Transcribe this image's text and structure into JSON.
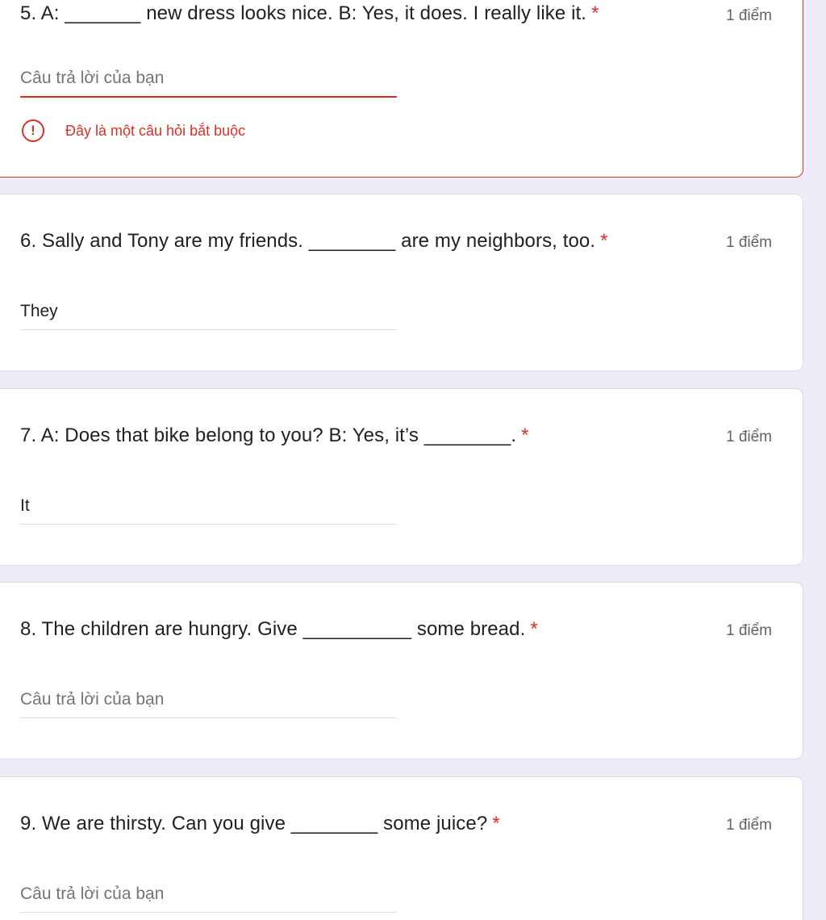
{
  "questions": [
    {
      "text": "5. A: _______ new dress looks nice. B: Yes, it does. I really like it.",
      "required_mark": "*",
      "points": "1 điểm",
      "answer_value": "",
      "answer_placeholder": "Câu trả lời của bạn",
      "error_message": "Đây là một câu hỏi bắt buộc"
    },
    {
      "text": "6. Sally and Tony are my friends. ________ are my neighbors, too.",
      "required_mark": "*",
      "points": "1 điểm",
      "answer_value": "They",
      "answer_placeholder": "Câu trả lời của bạn"
    },
    {
      "text": "7. A: Does that bike belong to you? B: Yes, it’s ________.",
      "required_mark": "*",
      "points": "1 điểm",
      "answer_value": "It",
      "answer_placeholder": "Câu trả lời của bạn"
    },
    {
      "text": "8. The children are hungry. Give __________ some bread.",
      "required_mark": "*",
      "points": "1 điểm",
      "answer_value": "",
      "answer_placeholder": "Câu trả lời của bạn"
    },
    {
      "text": "9. We are thirsty. Can you give ________ some juice?",
      "required_mark": "*",
      "points": "1 điểm",
      "answer_value": "",
      "answer_placeholder": "Câu trả lời của bạn"
    }
  ],
  "error_icon_glyph": "!",
  "colors": {
    "background": "#f0ebf8",
    "error": "#d93025",
    "text": "#202124",
    "secondary_text": "#5f6368"
  }
}
